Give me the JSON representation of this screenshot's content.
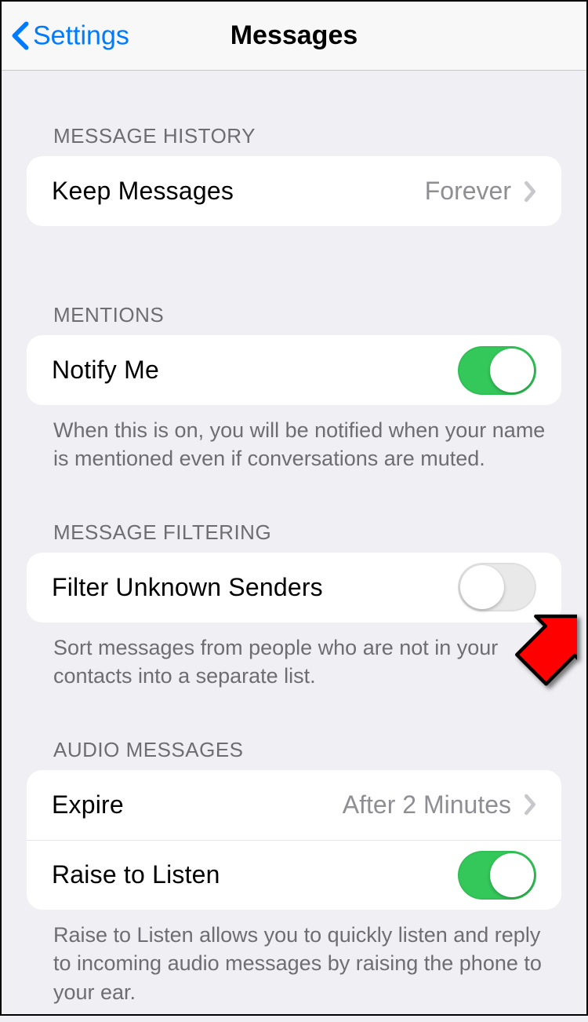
{
  "nav": {
    "back_label": "Settings",
    "title": "Messages"
  },
  "sections": {
    "history": {
      "header": "Message History",
      "keep_label": "Keep Messages",
      "keep_value": "Forever"
    },
    "mentions": {
      "header": "Mentions",
      "notify_label": "Notify Me",
      "notify_on": true,
      "footer": "When this is on, you will be notified when your name is mentioned even if conversations are muted."
    },
    "filtering": {
      "header": "Message Filtering",
      "filter_label": "Filter Unknown Senders",
      "filter_on": false,
      "footer": "Sort messages from people who are not in your contacts into a separate list."
    },
    "audio": {
      "header": "Audio Messages",
      "expire_label": "Expire",
      "expire_value": "After 2 Minutes",
      "raise_label": "Raise to Listen",
      "raise_on": true,
      "footer": "Raise to Listen allows you to quickly listen and reply to incoming audio messages by raising the phone to your ear."
    }
  }
}
